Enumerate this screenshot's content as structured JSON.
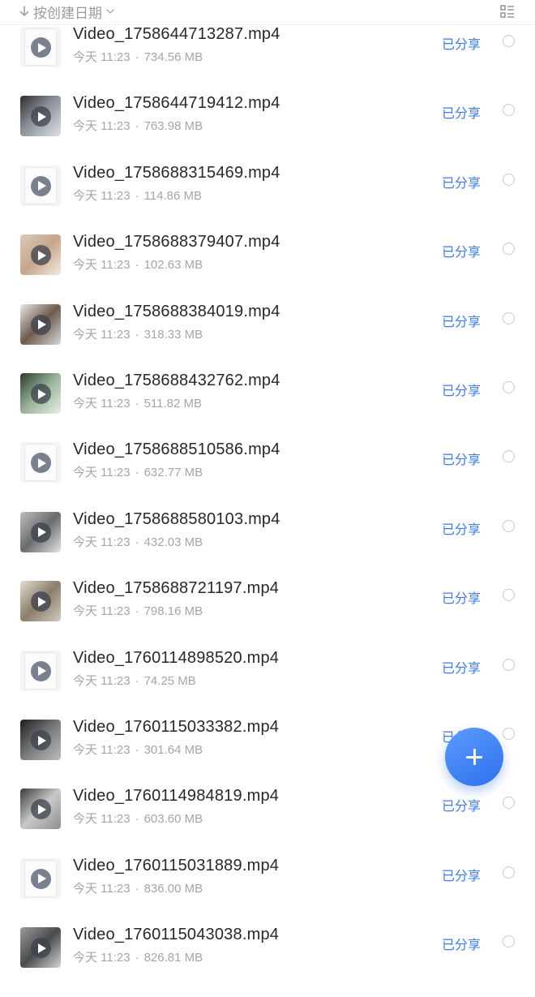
{
  "sort_bar": {
    "label": "按创建日期"
  },
  "files": [
    {
      "name": "Video_1758644713287.mp4",
      "date": "今天 11:23",
      "size": "734.56 MB",
      "share_status": "已分享",
      "thumb": "generic"
    },
    {
      "name": "Video_1758644719412.mp4",
      "date": "今天 11:23",
      "size": "763.98 MB",
      "share_status": "已分享",
      "thumb": "photo"
    },
    {
      "name": "Video_1758688315469.mp4",
      "date": "今天 11:23",
      "size": "114.86 MB",
      "share_status": "已分享",
      "thumb": "generic"
    },
    {
      "name": "Video_1758688379407.mp4",
      "date": "今天 11:23",
      "size": "102.63 MB",
      "share_status": "已分享",
      "thumb": "photo"
    },
    {
      "name": "Video_1758688384019.mp4",
      "date": "今天 11:23",
      "size": "318.33 MB",
      "share_status": "已分享",
      "thumb": "photo"
    },
    {
      "name": "Video_1758688432762.mp4",
      "date": "今天 11:23",
      "size": "511.82 MB",
      "share_status": "已分享",
      "thumb": "photo"
    },
    {
      "name": "Video_1758688510586.mp4",
      "date": "今天 11:23",
      "size": "632.77 MB",
      "share_status": "已分享",
      "thumb": "generic"
    },
    {
      "name": "Video_1758688580103.mp4",
      "date": "今天 11:23",
      "size": "432.03 MB",
      "share_status": "已分享",
      "thumb": "photo"
    },
    {
      "name": "Video_1758688721197.mp4",
      "date": "今天 11:23",
      "size": "798.16 MB",
      "share_status": "已分享",
      "thumb": "photo"
    },
    {
      "name": "Video_1760114898520.mp4",
      "date": "今天 11:23",
      "size": "74.25 MB",
      "share_status": "已分享",
      "thumb": "generic"
    },
    {
      "name": "Video_1760115033382.mp4",
      "date": "今天 11:23",
      "size": "301.64 MB",
      "share_status": "已分享",
      "thumb": "photo"
    },
    {
      "name": "Video_1760114984819.mp4",
      "date": "今天 11:23",
      "size": "603.60 MB",
      "share_status": "已分享",
      "thumb": "photo"
    },
    {
      "name": "Video_1760115031889.mp4",
      "date": "今天 11:23",
      "size": "836.00 MB",
      "share_status": "已分享",
      "thumb": "generic"
    },
    {
      "name": "Video_1760115043038.mp4",
      "date": "今天 11:23",
      "size": "826.81 MB",
      "share_status": "已分享",
      "thumb": "photo"
    }
  ],
  "icons": {
    "sort_arrow": "arrow-down-icon",
    "sort_chevron": "chevron-down-icon",
    "view_toggle": "list-view-icon",
    "play": "play-icon",
    "fab": "plus-icon"
  },
  "colors": {
    "accent": "#3d7be7",
    "text_primary": "#26282d",
    "text_secondary": "#a3a5aa",
    "fab_gradient_start": "#5a9cff",
    "fab_gradient_end": "#2f6fed"
  }
}
